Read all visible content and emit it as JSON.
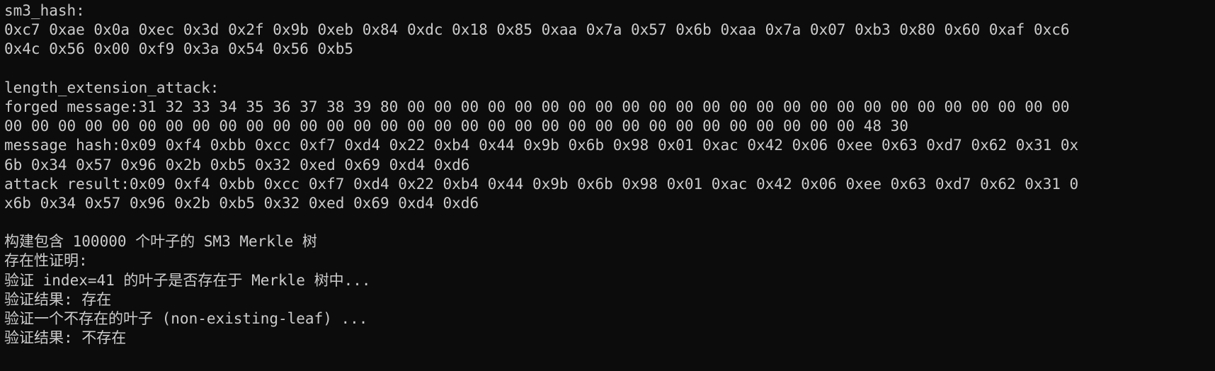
{
  "terminal": {
    "lines": [
      "sm3_hash:",
      "0xc7 0xae 0x0a 0xec 0x3d 0x2f 0x9b 0xeb 0x84 0xdc 0x18 0x85 0xaa 0x7a 0x57 0x6b 0xaa 0x7a 0x07 0xb3 0x80 0x60 0xaf 0xc6",
      "0x4c 0x56 0x00 0xf9 0x3a 0x54 0x56 0xb5",
      "",
      "length_extension_attack:",
      "forged message:31 32 33 34 35 36 37 38 39 80 00 00 00 00 00 00 00 00 00 00 00 00 00 00 00 00 00 00 00 00 00 00 00 00 00",
      "00 00 00 00 00 00 00 00 00 00 00 00 00 00 00 00 00 00 00 00 00 00 00 00 00 00 00 00 00 00 00 00 48 30",
      "message hash:0x09 0xf4 0xbb 0xcc 0xf7 0xd4 0x22 0xb4 0x44 0x9b 0x6b 0x98 0x01 0xac 0x42 0x06 0xee 0x63 0xd7 0x62 0x31 0x",
      "6b 0x34 0x57 0x96 0x2b 0xb5 0x32 0xed 0x69 0xd4 0xd6",
      "attack result:0x09 0xf4 0xbb 0xcc 0xf7 0xd4 0x22 0xb4 0x44 0x9b 0x6b 0x98 0x01 0xac 0x42 0x06 0xee 0x63 0xd7 0x62 0x31 0",
      "x6b 0x34 0x57 0x96 0x2b 0xb5 0x32 0xed 0x69 0xd4 0xd6",
      "",
      "构建包含 100000 个叶子的 SM3 Merkle 树",
      "存在性证明:",
      "验证 index=41 的叶子是否存在于 Merkle 树中...",
      "验证结果: 存在",
      "验证一个不存在的叶子 (non-existing-leaf) ...",
      "验证结果: 不存在"
    ]
  }
}
